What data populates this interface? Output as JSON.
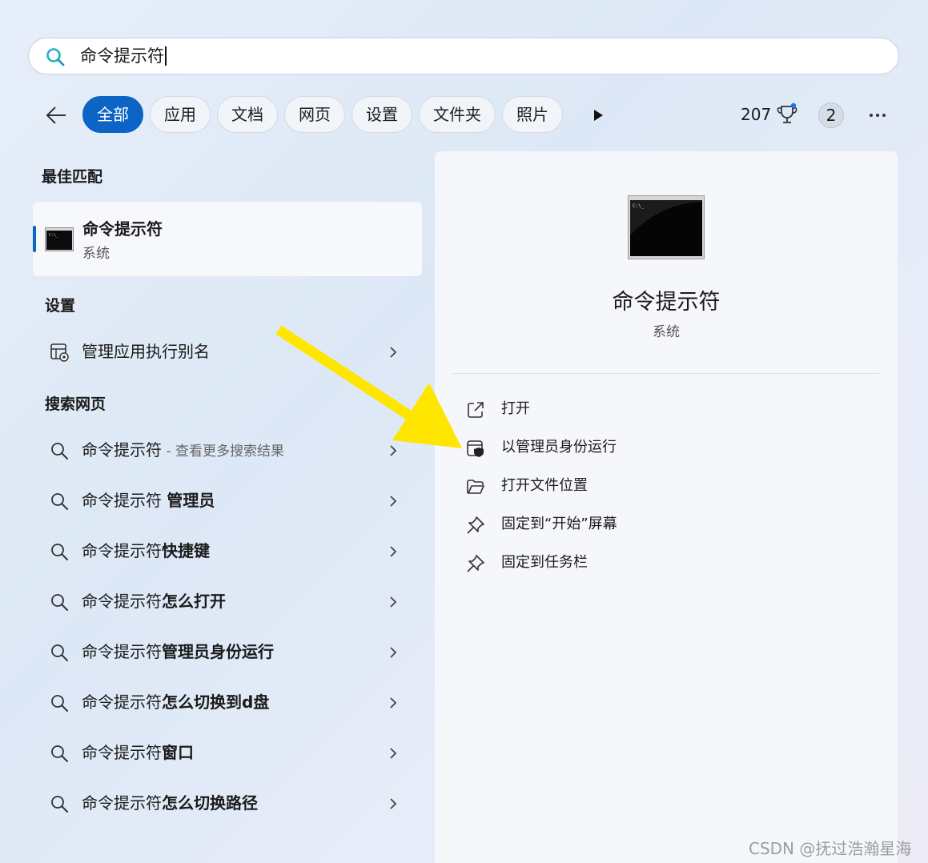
{
  "search": {
    "query": "命令提示符"
  },
  "filters": {
    "tabs": [
      {
        "label": "全部",
        "active": true
      },
      {
        "label": "应用"
      },
      {
        "label": "文档"
      },
      {
        "label": "网页"
      },
      {
        "label": "设置"
      },
      {
        "label": "文件夹"
      },
      {
        "label": "照片"
      }
    ],
    "points": "207",
    "badge_count": "2"
  },
  "sections": {
    "best_match": "最佳匹配",
    "settings": "设置",
    "web_search": "搜索网页"
  },
  "best_match": {
    "title": "命令提示符",
    "subtitle": "系统"
  },
  "settings_item": {
    "label": "管理应用执行别名"
  },
  "web_results": [
    {
      "prefix": "命令提示符",
      "bold": "",
      "suffix": " - 查看更多搜索结果"
    },
    {
      "prefix": "命令提示符 ",
      "bold": "管理员",
      "suffix": ""
    },
    {
      "prefix": "命令提示符",
      "bold": "快捷键",
      "suffix": ""
    },
    {
      "prefix": "命令提示符",
      "bold": "怎么打开",
      "suffix": ""
    },
    {
      "prefix": "命令提示符",
      "bold": "管理员身份运行",
      "suffix": ""
    },
    {
      "prefix": "命令提示符",
      "bold": "怎么切换到d盘",
      "suffix": ""
    },
    {
      "prefix": "命令提示符",
      "bold": "窗口",
      "suffix": ""
    },
    {
      "prefix": "命令提示符",
      "bold": "怎么切换路径",
      "suffix": ""
    }
  ],
  "detail": {
    "title": "命令提示符",
    "subtitle": "系统",
    "actions": [
      {
        "label": "打开",
        "icon": "open-external-icon"
      },
      {
        "label": "以管理员身份运行",
        "icon": "admin-shield-icon"
      },
      {
        "label": "打开文件位置",
        "icon": "folder-open-icon"
      },
      {
        "label": "固定到“开始”屏幕",
        "icon": "pin-icon"
      },
      {
        "label": "固定到任务栏",
        "icon": "pin-icon"
      }
    ]
  },
  "colors": {
    "accent": "#0c64c4",
    "highlight_arrow": "#ffe600"
  },
  "watermark": "CSDN @抚过浩瀚星海"
}
